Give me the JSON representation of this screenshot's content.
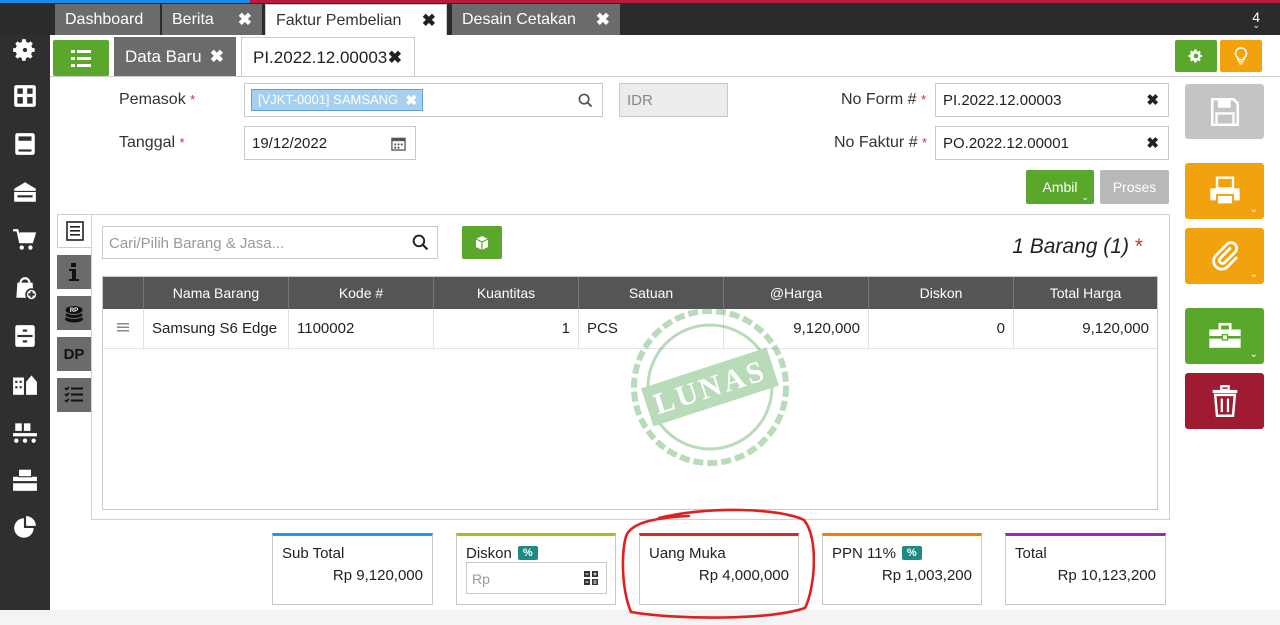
{
  "top_tabs": [
    {
      "label": "Dashboard",
      "closable": false,
      "active": false
    },
    {
      "label": "Berita",
      "closable": true,
      "active": false
    },
    {
      "label": "Faktur Pembelian",
      "closable": true,
      "active": true
    },
    {
      "label": "Desain Cetakan",
      "closable": true,
      "active": false
    }
  ],
  "top_count": "4",
  "sub_tabs": {
    "data_baru": "Data Baru",
    "record": "PI.2022.12.00003"
  },
  "form": {
    "pemasok_label": "Pemasok",
    "pemasok_value": "[VJKT-0001] SAMSANG",
    "currency": "IDR",
    "tanggal_label": "Tanggal",
    "tanggal_value": "19/12/2022",
    "noform_label": "No Form #",
    "noform_value": "PI.2022.12.00003",
    "nofaktur_label": "No Faktur #",
    "nofaktur_value": "PO.2022.12.00001",
    "required_mark": "*"
  },
  "actions": {
    "ambil": "Ambil",
    "proses": "Proses"
  },
  "detail": {
    "search_placeholder": "Cari/Pilih Barang & Jasa...",
    "count_label": "1 Barang (1)",
    "vertical_tabs": [
      "list-icon",
      "info-icon",
      "rp-coins-icon",
      "DP",
      "checklist-icon"
    ],
    "dp_label": "DP",
    "columns": [
      "Nama Barang",
      "Kode #",
      "Kuantitas",
      "Satuan",
      "@Harga",
      "Diskon",
      "Total Harga"
    ],
    "rows": [
      {
        "nama": "Samsung S6 Edge",
        "kode": "1100002",
        "qty": "1",
        "satuan": "PCS",
        "harga": "9,120,000",
        "diskon": "0",
        "total": "9,120,000"
      }
    ],
    "stamp": "LUNAS"
  },
  "summary": {
    "subtotal_label": "Sub Total",
    "subtotal_value": "Rp 9,120,000",
    "diskon_label": "Diskon",
    "diskon_placeholder": "Rp",
    "pct": "%",
    "uangmuka_label": "Uang Muka",
    "uangmuka_value": "Rp 4,000,000",
    "ppn_label": "PPN 11%",
    "ppn_value": "Rp 1,003,200",
    "total_label": "Total",
    "total_value": "Rp 10,123,200"
  },
  "colors": {
    "green": "#5aa82b",
    "orange": "#f2a20c",
    "red": "#9e1b32",
    "teal": "#1e8a80",
    "annotation": "#e02020"
  }
}
